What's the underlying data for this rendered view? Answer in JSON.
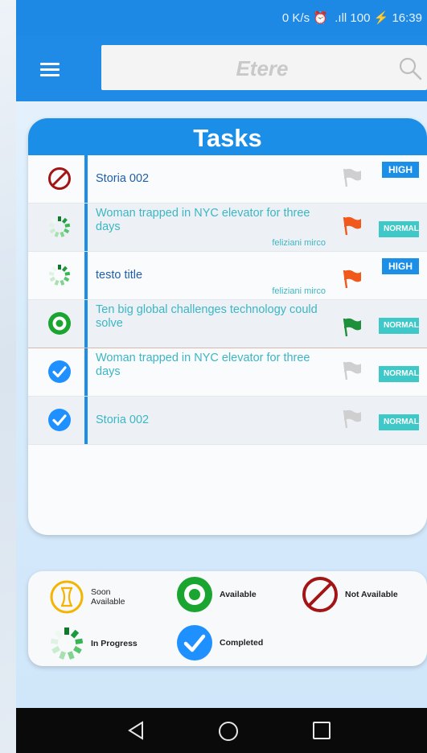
{
  "status_bar": {
    "text": "0 K/s ⏰ ︎ .ıll 100 ⚡ 16:39"
  },
  "search": {
    "placeholder": "Etere"
  },
  "card": {
    "title": "Tasks"
  },
  "tasks": [
    {
      "status": "not-available",
      "title": "Storia 002",
      "title_color": "#1f5fa8",
      "assignee": "",
      "flag": "#cfcfcf",
      "badge": "HIGH",
      "badge_type": "high",
      "alt": false
    },
    {
      "status": "in-progress",
      "title": "Woman trapped in NYC elevator for three days",
      "title_color": "#3bb6c4",
      "assignee": "feliziani mirco",
      "flag": "#f1581c",
      "badge": "NORMAL",
      "badge_type": "normal",
      "alt": true
    },
    {
      "status": "in-progress",
      "title": "testo title",
      "title_color": "#1f5fa8",
      "assignee": "feliziani mirco",
      "flag": "#f1581c",
      "badge": "HIGH",
      "badge_type": "high",
      "alt": false
    },
    {
      "status": "available",
      "title": "Ten big global challenges technology could solve",
      "title_color": "#3bb6c4",
      "assignee": "",
      "flag": "#1e8f3a",
      "badge": "NORMAL",
      "badge_type": "normal",
      "alt": true
    },
    {
      "status": "completed",
      "title": "Woman trapped in NYC elevator for three days",
      "title_color": "#3bb6c4",
      "assignee": "",
      "flag": "#cfcfcf",
      "badge": "NORMAL",
      "badge_type": "normal",
      "alt": false
    },
    {
      "status": "completed",
      "title": "Storia 002",
      "title_color": "#3bb6c4",
      "assignee": "",
      "flag": "#cfcfcf",
      "badge": "NORMAL",
      "badge_type": "normal",
      "alt": true
    }
  ],
  "legend": {
    "soon_available": "Soon Available",
    "available": "Available",
    "not_available": "Not Available",
    "in_progress": "In Progress",
    "completed": "Completed"
  },
  "colors": {
    "primary": "#1b8fe8",
    "available_green": "#1aa531",
    "not_available_red": "#a31414",
    "completed_blue": "#1e90ff",
    "soon_yellow": "#f4b400"
  }
}
